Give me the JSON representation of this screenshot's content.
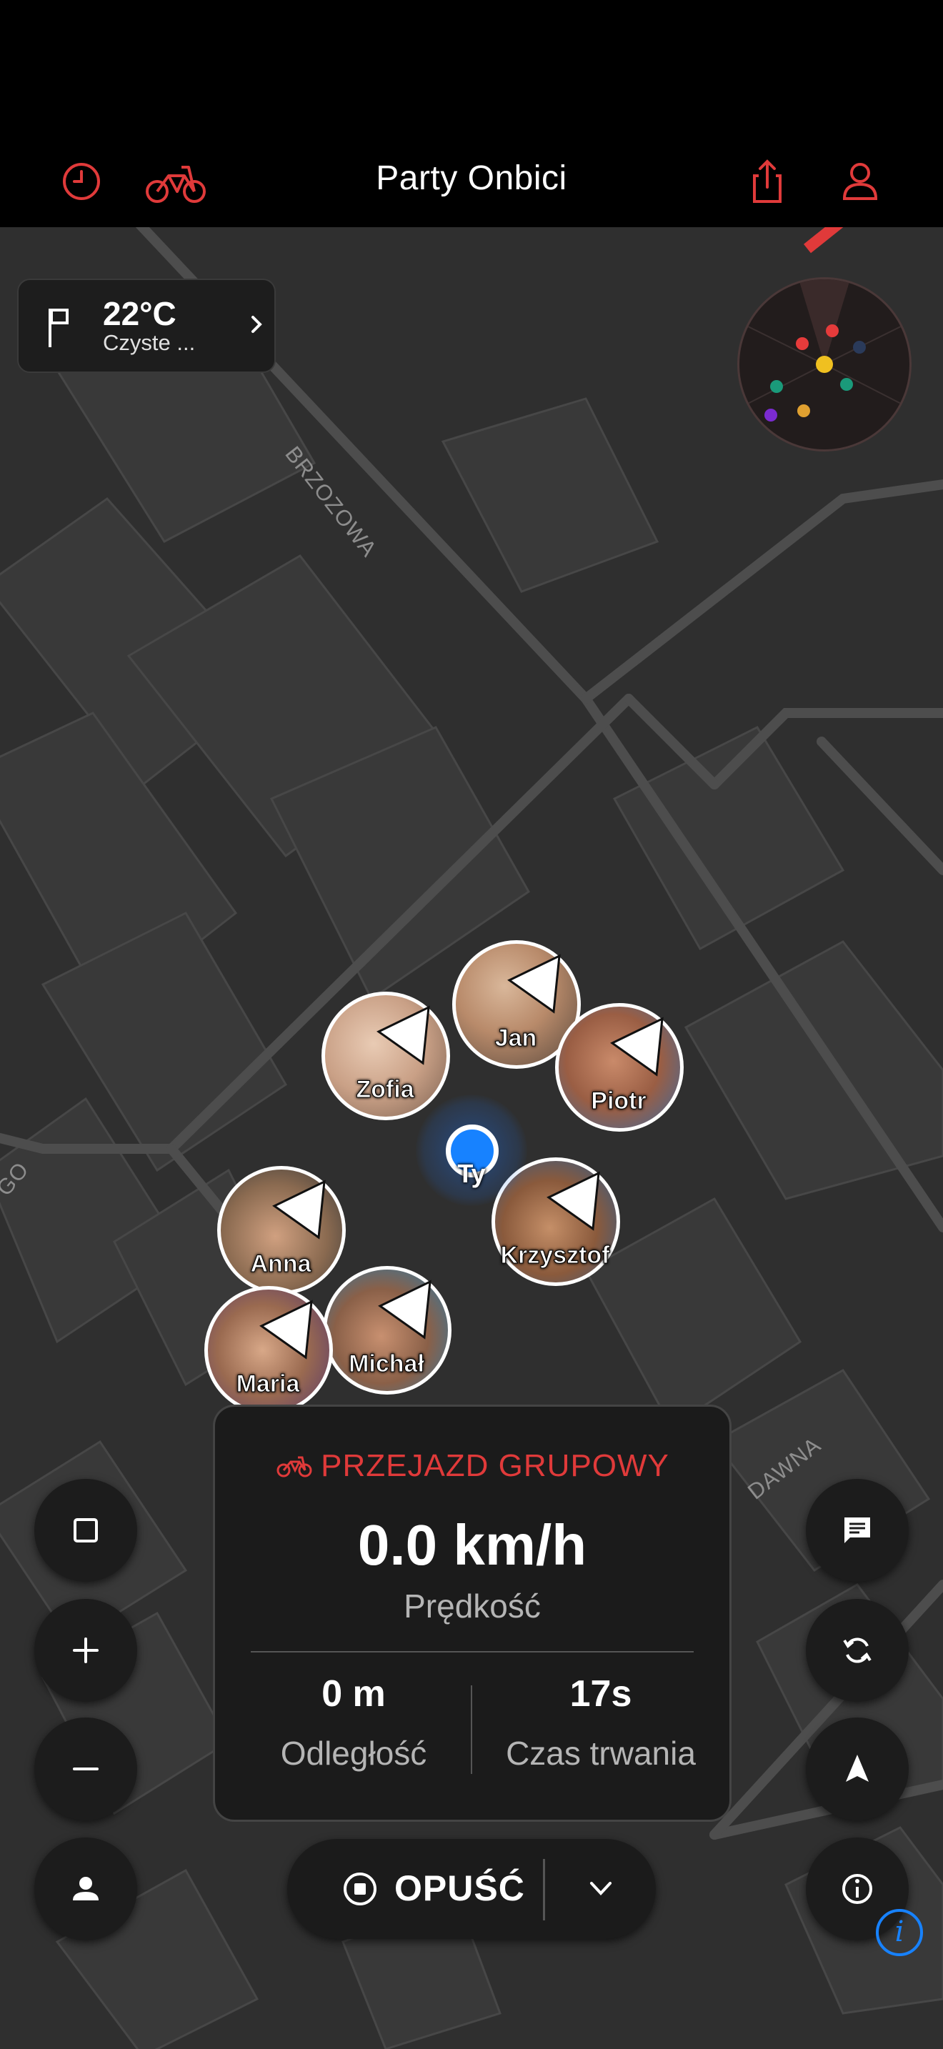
{
  "header": {
    "title": "Party Onbici",
    "icons": [
      "history-icon",
      "bike-icon",
      "share-icon",
      "profile-icon"
    ],
    "accent_color": "#e03a3a"
  },
  "weather": {
    "temperature": "22°C",
    "condition": "Czyste ..."
  },
  "map": {
    "street_labels": [
      "BRZOZOWA",
      "DAWNA",
      "GO"
    ]
  },
  "riders": [
    {
      "name": "Jan"
    },
    {
      "name": "Zofia"
    },
    {
      "name": "Piotr"
    },
    {
      "name": "Krzysztof"
    },
    {
      "name": "Anna"
    },
    {
      "name": "Michał"
    },
    {
      "name": "Maria"
    }
  ],
  "me": {
    "label": "Ty",
    "color": "#1782ff"
  },
  "ride_panel": {
    "mode": "PRZEJAZD GRUPOWY",
    "speed": "0.0 km/h",
    "speed_label": "Prędkość",
    "distance": "0 m",
    "distance_label": "Odległość",
    "duration": "17s",
    "duration_label": "Czas trwania"
  },
  "leave_button": {
    "label": "OPUŚĆ"
  },
  "left_controls": [
    "square-icon",
    "zoom-in-icon",
    "zoom-out-icon",
    "person-icon"
  ],
  "right_controls": [
    "chat-icon",
    "sync-icon",
    "navigate-icon",
    "info-icon"
  ],
  "radar_dot_colors": [
    "#e63b3b",
    "#e63b3b",
    "#f0c020",
    "#1a9a7a",
    "#1a9a7a",
    "#e0a030",
    "#7b2bd0",
    "#2a3a5a"
  ]
}
